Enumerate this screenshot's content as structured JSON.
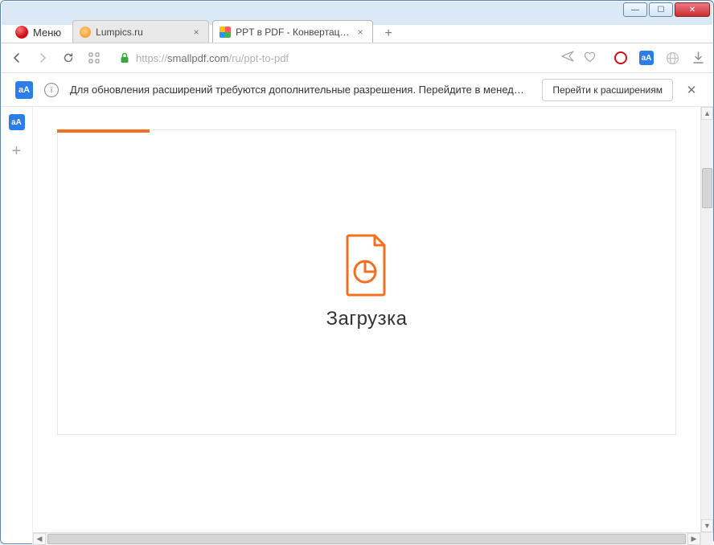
{
  "window": {
    "minimize_glyph": "—",
    "maximize_glyph": "☐",
    "close_glyph": "✕"
  },
  "menu": {
    "label": "Меню"
  },
  "tabs": [
    {
      "title": "Lumpics.ru",
      "close": "×"
    },
    {
      "title": "PPT в PDF - Конвертация",
      "close": "×"
    }
  ],
  "newtab_glyph": "+",
  "address": {
    "protocol": "https://",
    "host": "smallpdf.com",
    "path": "/ru/ppt-to-pdf"
  },
  "notice": {
    "info_glyph": "i",
    "text": "Для обновления расширений требуются дополнительные разрешения. Перейдите в менедже…",
    "button": "Перейти к расширениям",
    "close": "✕"
  },
  "page": {
    "loading_label": "Загрузка"
  },
  "icons": {
    "translate_badge": "аА"
  },
  "colors": {
    "accent": "#f37021"
  }
}
